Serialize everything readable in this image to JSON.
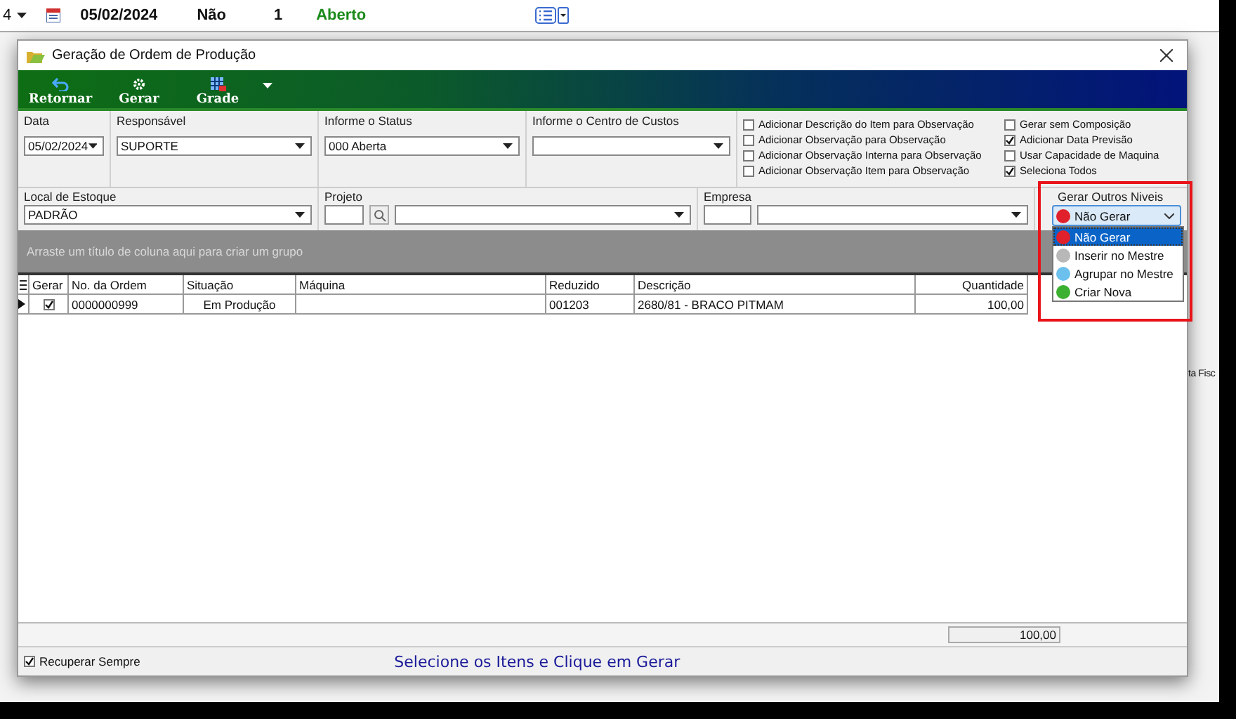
{
  "background_app": {
    "top_row": {
      "combo_value": "4",
      "date": "05/02/2024",
      "flag": "Não",
      "count": "1",
      "status": "Aberto"
    },
    "side_text": "ta Fisc"
  },
  "dialog": {
    "title": "Geração de Ordem de Produção"
  },
  "toolbar": [
    {
      "label": "Retornar",
      "kind": "back"
    },
    {
      "label": "Gerar",
      "kind": "gear"
    },
    {
      "label": "Grade",
      "kind": "grid"
    }
  ],
  "filters": {
    "data": {
      "label": "Data",
      "value": "05/02/2024"
    },
    "responsavel": {
      "label": "Responsável",
      "value": "SUPORTE"
    },
    "status": {
      "label": "Informe o Status",
      "value": "000 Aberta"
    },
    "centro_custos": {
      "label": "Informe o Centro de Custos"
    },
    "local_estoque": {
      "label": "Local de Estoque",
      "value": "PADRÃO"
    },
    "projeto": {
      "label": "Projeto"
    },
    "empresa": {
      "label": "Empresa"
    }
  },
  "options": [
    {
      "label": "Adicionar Descrição do Item para Observação",
      "checked": false
    },
    {
      "label": "Adicionar Observação para Observação",
      "checked": false
    },
    {
      "label": "Adicionar Observação Interna para Observação",
      "checked": false
    },
    {
      "label": "Adicionar Observação Item para Observação",
      "checked": false
    },
    {
      "label": "Gerar sem Composição",
      "checked": false
    },
    {
      "label": "Adicionar Data Previsão",
      "checked": true
    },
    {
      "label": "Usar Capacidade de Maquina",
      "checked": false
    },
    {
      "label": "Seleciona Todos",
      "checked": true
    }
  ],
  "outros_niveis": {
    "label": "Gerar Outros Niveis",
    "value": "Não Gerar",
    "items": [
      {
        "label": "Não Gerar",
        "color": "#e0202a",
        "selected": true
      },
      {
        "label": "Inserir no Mestre",
        "color": "#b8b8b8",
        "selected": false
      },
      {
        "label": "Agrupar no Mestre",
        "color": "#6cc0ee",
        "selected": false
      },
      {
        "label": "Criar Nova",
        "color": "#3cb030",
        "selected": false
      }
    ]
  },
  "group_panel_hint": "Arraste um título de coluna aqui para criar um grupo",
  "table": {
    "columns": [
      "Gerar",
      "No. da Ordem",
      "Situação",
      "Máquina",
      "Reduzido",
      "Descrição",
      "Quantidade"
    ],
    "rows": [
      {
        "gerar": true,
        "ordem": "0000000999",
        "situacao": "Em Produção",
        "reduzido": "001203",
        "descricao": "2680/81 - BRACO PITMAM",
        "quantidade": "100,00"
      }
    ]
  },
  "footer": {
    "total": "100,00",
    "recuperar_sempre": true,
    "recuperar_label": "Recuperar Sempre",
    "hint": "Selecione os Itens e Clique em Gerar"
  }
}
